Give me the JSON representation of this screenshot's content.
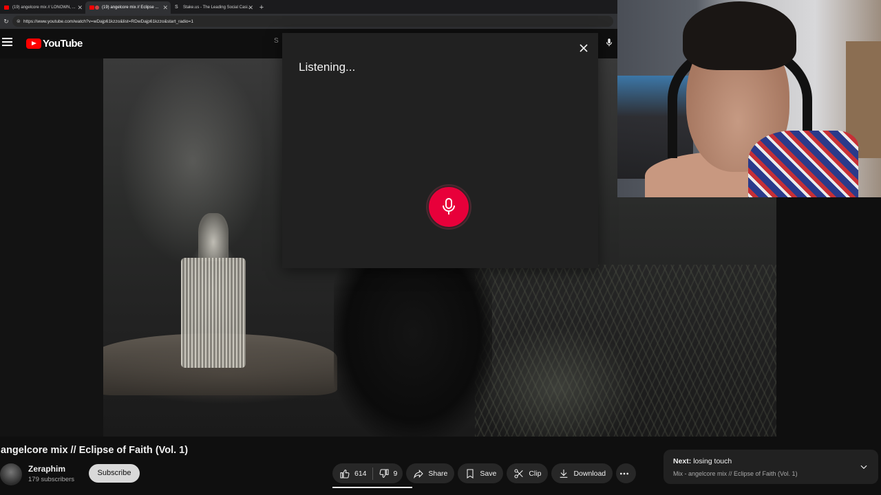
{
  "browser": {
    "tabs": [
      {
        "title": "(19) angelcore mix // LONOWN, ..."
      },
      {
        "title": "(19) angelcore mix // Eclipse ..."
      },
      {
        "title": "Stake.us - The Leading Social Casi..."
      }
    ],
    "new_tab": "+",
    "url": "https://www.youtube.com/watch?v=wDajp61kzzo&list=RDwDajp61kzzo&start_radio=1"
  },
  "header": {
    "logo_text": "YouTube",
    "search_partial": "S"
  },
  "voice_search": {
    "status": "Listening...",
    "accent": "#e8003a"
  },
  "video": {
    "title": "angelcore mix // Eclipse of Faith (Vol. 1)"
  },
  "channel": {
    "name": "Zeraphim",
    "subscribers": "179 subscribers",
    "subscribe_label": "Subscribe"
  },
  "actions": {
    "likes": "614",
    "dislikes": "9",
    "share": "Share",
    "save": "Save",
    "clip": "Clip",
    "download": "Download"
  },
  "next_up": {
    "prefix": "Next:",
    "title": "losing touch",
    "playlist": "Mix - angelcore mix // Eclipse of Faith (Vol. 1)"
  },
  "icons": [
    "menu-icon",
    "mic-icon",
    "close-icon",
    "like-icon",
    "dislike-icon",
    "share-icon",
    "save-icon",
    "clip-icon",
    "download-icon",
    "more-icon",
    "chevron-down-icon"
  ]
}
